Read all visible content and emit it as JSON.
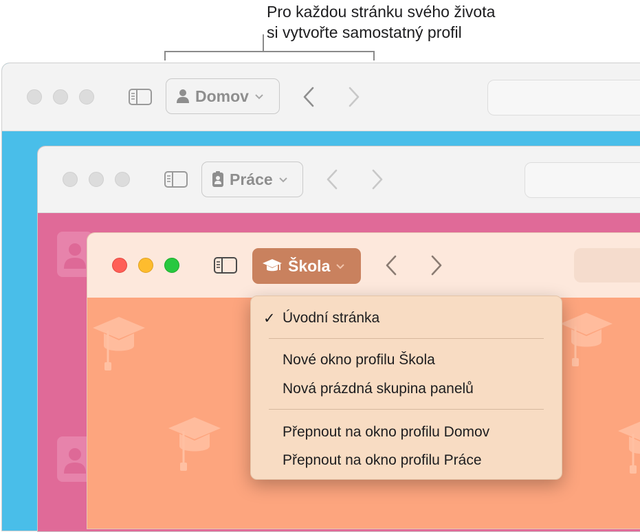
{
  "callout": {
    "line1": "Pro každou stránku svého života",
    "line2": "si vytvořte samostatný profil"
  },
  "windows": {
    "home": {
      "profile_label": "Domov",
      "accent": "#49bee9"
    },
    "work": {
      "profile_label": "Práce",
      "accent": "#e06a98"
    },
    "school": {
      "profile_label": "Škola",
      "accent": "#fda57e",
      "button_color": "#c9815e"
    }
  },
  "menu": {
    "checked_item": "Úvodní stránka",
    "group1": [
      "Nové okno profilu Škola",
      "Nová prázdná skupina panelů"
    ],
    "group2": [
      "Přepnout na okno profilu Domov",
      "Přepnout na okno profilu Práce"
    ]
  },
  "icons": {
    "home_profile": "person-icon",
    "work_profile": "badge-icon",
    "school_profile": "graduation-cap-icon",
    "sidebar": "sidebar-icon",
    "back": "chevron-left-icon",
    "forward": "chevron-right-icon"
  }
}
